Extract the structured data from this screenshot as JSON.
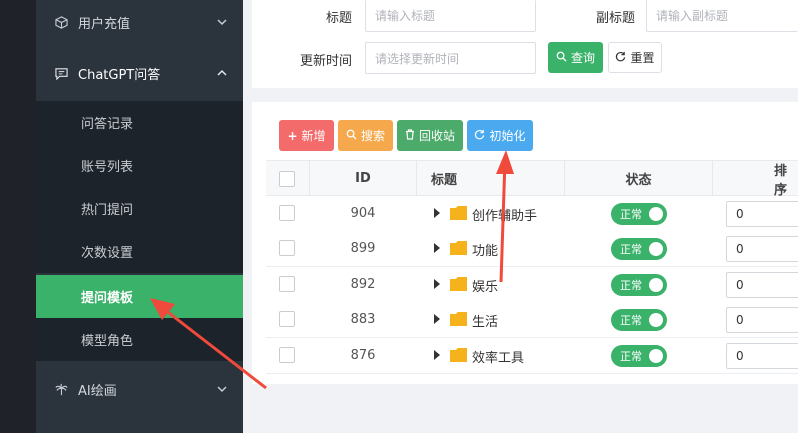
{
  "sidebar": {
    "groups": [
      {
        "label": "用户充值",
        "icon": "cube-icon"
      },
      {
        "label": "ChatGPT问答",
        "icon": "chat-icon"
      },
      {
        "label": "AI绘画",
        "icon": "palm-icon"
      }
    ],
    "items": [
      {
        "label": "问答记录"
      },
      {
        "label": "账号列表"
      },
      {
        "label": "热门提问"
      },
      {
        "label": "次数设置"
      },
      {
        "label": "提问模板"
      },
      {
        "label": "模型角色"
      }
    ]
  },
  "filters": {
    "title_label": "标题",
    "title_placeholder": "请输入标题",
    "subtitle_label": "副标题",
    "subtitle_placeholder": "请输入副标题",
    "update_label": "更新时间",
    "update_placeholder": "请选择更新时间",
    "query_label": "查询",
    "reset_label": "重置"
  },
  "toolbar": {
    "add_label": "新增",
    "search_label": "搜索",
    "recycle_label": "回收站",
    "init_label": "初始化"
  },
  "table": {
    "headers": {
      "id": "ID",
      "title": "标题",
      "status": "状态",
      "sort": "排序"
    },
    "rows": [
      {
        "id": "904",
        "title": "创作辅助手",
        "status": "正常",
        "sort": "0"
      },
      {
        "id": "899",
        "title": "功能",
        "status": "正常",
        "sort": "0"
      },
      {
        "id": "892",
        "title": "娱乐",
        "status": "正常",
        "sort": "0"
      },
      {
        "id": "883",
        "title": "生活",
        "status": "正常",
        "sort": "0"
      },
      {
        "id": "876",
        "title": "效率工具",
        "status": "正常",
        "sort": "0"
      }
    ]
  },
  "colors": {
    "accent": "#3ab26a",
    "add": "#f36b6b",
    "search": "#f5a94c",
    "recycle": "#4caa6a",
    "init": "#4ba9f0",
    "sidebar_bg": "#2b333d",
    "annotation_arrow": "#f04a3c"
  }
}
